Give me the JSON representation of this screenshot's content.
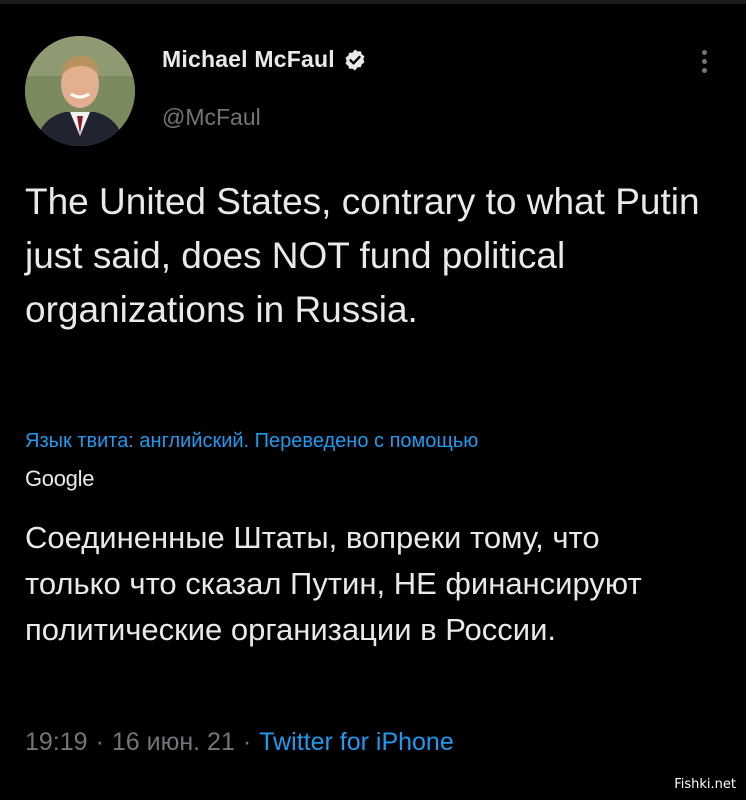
{
  "author": {
    "name": "Michael McFaul",
    "handle": "@McFaul",
    "verified": true
  },
  "tweet": {
    "text": "The United States, contrary to what Putin just said, does NOT fund political organizations in Russia.",
    "translation_note": "Язык твита: английский. Переведено с помощью",
    "translation_provider": "Google",
    "translated_text": "Соединенные Штаты, вопреки тому, что только что сказал Путин, НЕ финансируют политические организации в России."
  },
  "meta": {
    "time": "19:19",
    "separator": "·",
    "date": "16 июн. 21",
    "source": "Twitter for iPhone"
  },
  "watermark": "Fishki.net",
  "colors": {
    "background": "#000000",
    "text": "#e7e9ea",
    "muted": "#71767b",
    "accent": "#1d9bf0"
  },
  "icons": {
    "verified": "verified-badge-icon",
    "more": "more-vertical-icon"
  }
}
